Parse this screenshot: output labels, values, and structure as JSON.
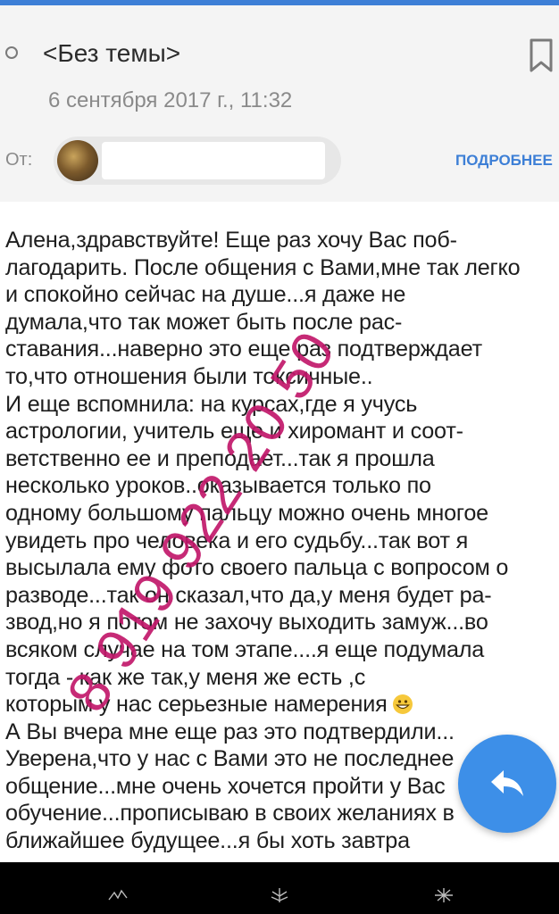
{
  "message": {
    "subject": "<Без темы>",
    "date": "6 сентября 2017 г., 11:32",
    "from_label": "От:",
    "details_link": "ПОДРОБНЕЕ",
    "body": "Алена,здравствуйте! Еще раз хочу Вас поб-\nлагодарить. После общения с Вами,мне так легко\nи спокойно сейчас на душе...я даже не\nдумала,что так может быть после рас-\nставания...наверно это еще раз подтверждает\nто,что отношения были токсичные..\nИ еще вспомнила: на курсах,где я учусь\nастрологии, учитель еще и хиромант и соот-\nветственно ее и преподает...так я прошла\nнесколько уроков..оказывается только по\nодному большому пальцу можно очень многое\nувидеть про человека и его судьбу...так вот я\nвысылала ему фото своего пальца с вопросом о\nразводе...так он сказал,что да,у меня будет ра-\nзвод,но я потом не захочу выходить замуж...во\nвсяком случае на том этапе....я еще подумала\nтогда - как же так,у меня же есть        ,с\nкоторым у нас серьезные намерения",
    "body_after_emoji": "\nА Вы вчера мне еще раз это подтвердили...\nУверена,что у нас с Вами это не последнее\nобщение...мне очень хочется пройти у Вас\nобучение...прописываю в своих желаниях в\nближайшее будущее...я бы хоть завтра"
  },
  "watermark": "8 919 922 20 50",
  "icons": {
    "radio": "radio-circle-icon",
    "bookmark": "bookmark-icon",
    "reply": "reply-icon",
    "emoji": "grinning-face-icon"
  },
  "colors": {
    "accent": "#3d7fd6",
    "fab": "#3d8fe8",
    "watermark": "#c2186b",
    "header_bg": "#f4f4f4"
  }
}
